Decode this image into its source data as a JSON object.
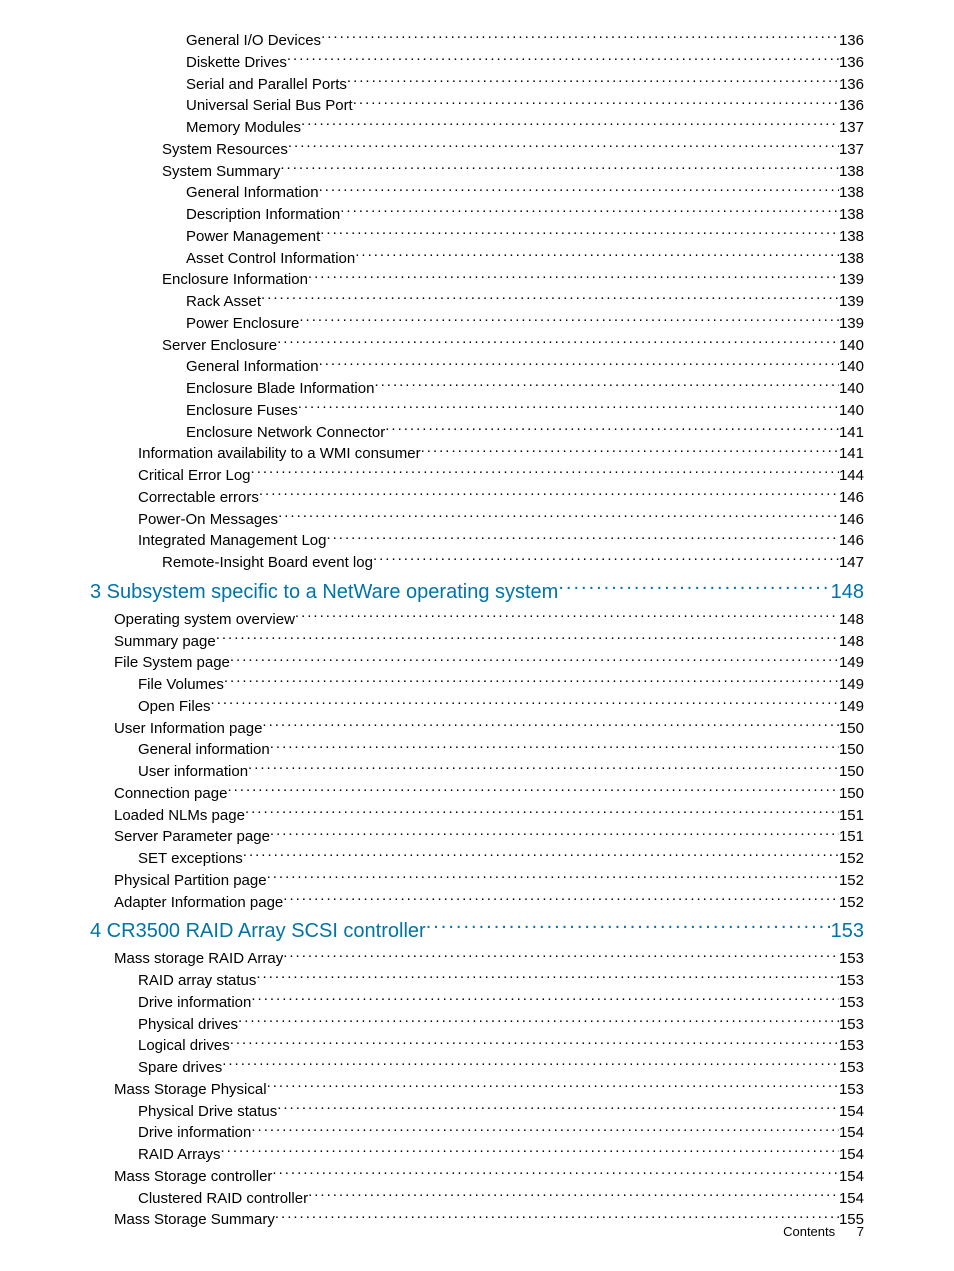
{
  "toc": [
    {
      "label": "General I/O Devices",
      "page": "136",
      "indent": 4,
      "type": "entry"
    },
    {
      "label": "Diskette Drives",
      "page": "136",
      "indent": 4,
      "type": "entry"
    },
    {
      "label": "Serial and Parallel Ports",
      "page": "136",
      "indent": 4,
      "type": "entry"
    },
    {
      "label": "Universal Serial Bus Port",
      "page": "136",
      "indent": 4,
      "type": "entry"
    },
    {
      "label": "Memory Modules",
      "page": "137",
      "indent": 4,
      "type": "entry"
    },
    {
      "label": "System Resources ",
      "page": "137",
      "indent": 3,
      "type": "entry"
    },
    {
      "label": "System Summary ",
      "page": "138",
      "indent": 3,
      "type": "entry"
    },
    {
      "label": "General Information",
      "page": "138",
      "indent": 4,
      "type": "entry"
    },
    {
      "label": "Description Information",
      "page": "138",
      "indent": 4,
      "type": "entry"
    },
    {
      "label": "Power Management",
      "page": "138",
      "indent": 4,
      "type": "entry"
    },
    {
      "label": "Asset Control Information",
      "page": "138",
      "indent": 4,
      "type": "entry"
    },
    {
      "label": "Enclosure Information",
      "page": "139",
      "indent": 3,
      "type": "entry"
    },
    {
      "label": "Rack Asset",
      "page": "139",
      "indent": 4,
      "type": "entry"
    },
    {
      "label": "Power Enclosure",
      "page": "139",
      "indent": 4,
      "type": "entry"
    },
    {
      "label": "Server Enclosure",
      "page": "140",
      "indent": 3,
      "type": "entry"
    },
    {
      "label": "General Information",
      "page": "140",
      "indent": 4,
      "type": "entry"
    },
    {
      "label": "Enclosure Blade Information",
      "page": "140",
      "indent": 4,
      "type": "entry"
    },
    {
      "label": "Enclosure Fuses",
      "page": "140",
      "indent": 4,
      "type": "entry"
    },
    {
      "label": "Enclosure Network Connector",
      "page": "141",
      "indent": 4,
      "type": "entry"
    },
    {
      "label": "Information availability to a WMI consumer",
      "page": "141",
      "indent": 2,
      "type": "entry"
    },
    {
      "label": "Critical Error Log",
      "page": "144",
      "indent": 2,
      "type": "entry"
    },
    {
      "label": "Correctable errors",
      "page": "146",
      "indent": 2,
      "type": "entry"
    },
    {
      "label": "Power-On Messages",
      "page": "146",
      "indent": 2,
      "type": "entry"
    },
    {
      "label": "Integrated Management Log",
      "page": "146",
      "indent": 2,
      "type": "entry"
    },
    {
      "label": "Remote-Insight Board event log",
      "page": "147",
      "indent": 3,
      "type": "entry"
    },
    {
      "label": "3 Subsystem specific to a NetWare operating system",
      "page": "148",
      "indent": 0,
      "type": "chapter"
    },
    {
      "label": "Operating system overview",
      "page": "148",
      "indent": 1,
      "type": "entry"
    },
    {
      "label": "Summary page",
      "page": "148",
      "indent": 1,
      "type": "entry"
    },
    {
      "label": "File System page",
      "page": "149",
      "indent": 1,
      "type": "entry"
    },
    {
      "label": "File Volumes",
      "page": "149",
      "indent": 2,
      "type": "entry"
    },
    {
      "label": "Open Files",
      "page": "149",
      "indent": 2,
      "type": "entry"
    },
    {
      "label": "User Information page",
      "page": "150",
      "indent": 1,
      "type": "entry"
    },
    {
      "label": "General information",
      "page": "150",
      "indent": 2,
      "type": "entry"
    },
    {
      "label": "User information",
      "page": "150",
      "indent": 2,
      "type": "entry"
    },
    {
      "label": "Connection page",
      "page": "150",
      "indent": 1,
      "type": "entry"
    },
    {
      "label": "Loaded NLMs page",
      "page": "151",
      "indent": 1,
      "type": "entry"
    },
    {
      "label": "Server Parameter page",
      "page": "151",
      "indent": 1,
      "type": "entry"
    },
    {
      "label": "SET exceptions",
      "page": "152",
      "indent": 2,
      "type": "entry"
    },
    {
      "label": "Physical Partition page",
      "page": "152",
      "indent": 1,
      "type": "entry"
    },
    {
      "label": "Adapter Information page",
      "page": "152",
      "indent": 1,
      "type": "entry"
    },
    {
      "label": "4 CR3500 RAID Array SCSI controller",
      "page": "153",
      "indent": 0,
      "type": "chapter"
    },
    {
      "label": "Mass storage RAID Array",
      "page": "153",
      "indent": 1,
      "type": "entry"
    },
    {
      "label": "RAID array status",
      "page": "153",
      "indent": 2,
      "type": "entry"
    },
    {
      "label": "Drive information",
      "page": "153",
      "indent": 2,
      "type": "entry"
    },
    {
      "label": "Physical drives ",
      "page": "153",
      "indent": 2,
      "type": "entry"
    },
    {
      "label": "Logical drives",
      "page": "153",
      "indent": 2,
      "type": "entry"
    },
    {
      "label": "Spare drives",
      "page": "153",
      "indent": 2,
      "type": "entry"
    },
    {
      "label": "Mass Storage Physical",
      "page": "153",
      "indent": 1,
      "type": "entry"
    },
    {
      "label": "Physical Drive status",
      "page": "154",
      "indent": 2,
      "type": "entry"
    },
    {
      "label": "Drive information",
      "page": "154",
      "indent": 2,
      "type": "entry"
    },
    {
      "label": "RAID Arrays",
      "page": "154",
      "indent": 2,
      "type": "entry"
    },
    {
      "label": "Mass Storage controller",
      "page": "154",
      "indent": 1,
      "type": "entry"
    },
    {
      "label": "Clustered RAID controller",
      "page": "154",
      "indent": 2,
      "type": "entry"
    },
    {
      "label": "Mass Storage Summary",
      "page": "155",
      "indent": 1,
      "type": "entry"
    }
  ],
  "footer": {
    "label": "Contents",
    "page": "7"
  }
}
